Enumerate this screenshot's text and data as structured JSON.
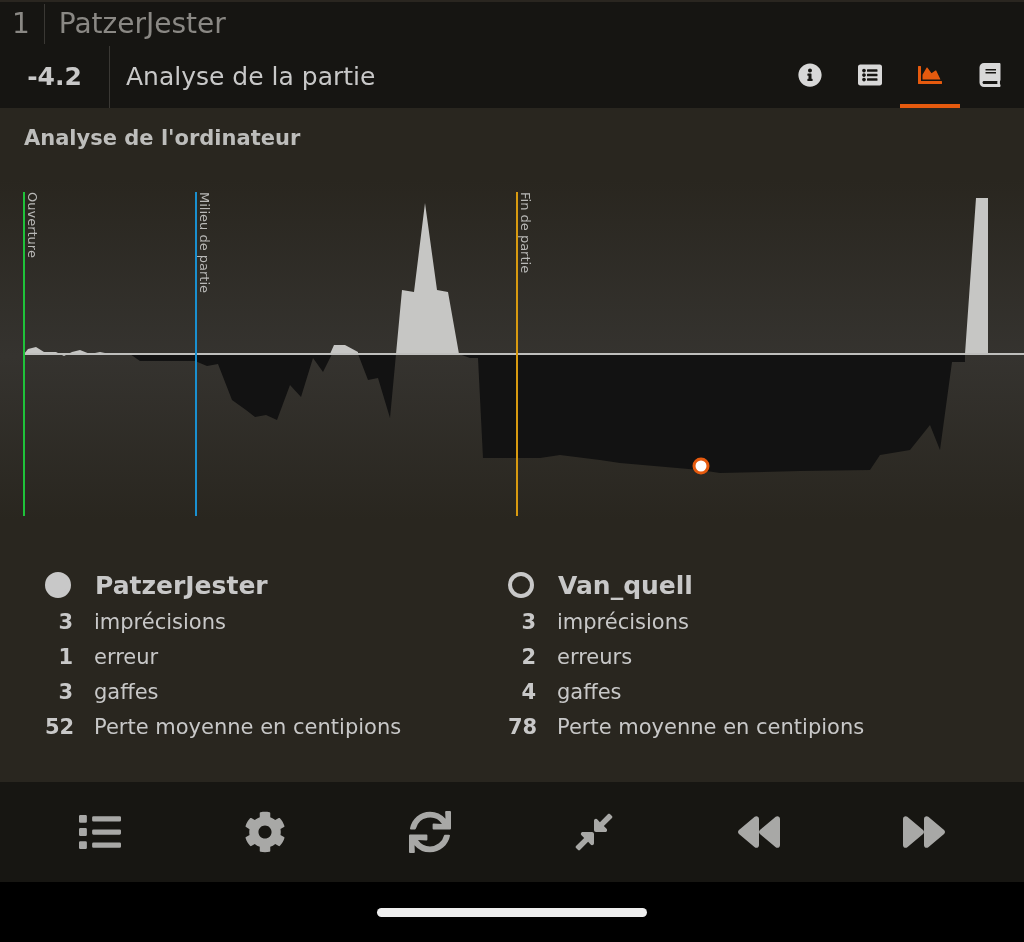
{
  "top_bar": {
    "move_number": "1",
    "player": "PatzerJester"
  },
  "header": {
    "evaluation": "-4.2",
    "title": "Analyse de la partie",
    "tabs": [
      {
        "kind": "info",
        "selected": false
      },
      {
        "kind": "list",
        "selected": false
      },
      {
        "kind": "chart",
        "selected": true
      },
      {
        "kind": "book",
        "selected": false
      }
    ]
  },
  "section_title": "Analyse de l'ordinateur",
  "phases": [
    {
      "label": "Ouverture",
      "color": "#1fc23a"
    },
    {
      "label": "Milieu de partie",
      "color": "#1a90d0"
    },
    {
      "label": "Fin de partie",
      "color": "#d89a10"
    }
  ],
  "players": [
    {
      "name": "PatzerJester",
      "kind": "white",
      "stats": [
        {
          "count": "3",
          "label": "imprécisions"
        },
        {
          "count": "1",
          "label": "erreur"
        },
        {
          "count": "3",
          "label": "gaffes"
        },
        {
          "count": "52",
          "label": "Perte moyenne en centipions"
        }
      ]
    },
    {
      "name": "Van_quell",
      "kind": "black",
      "stats": [
        {
          "count": "3",
          "label": "imprécisions"
        },
        {
          "count": "2",
          "label": "erreurs"
        },
        {
          "count": "4",
          "label": "gaffes"
        },
        {
          "count": "78",
          "label": "Perte moyenne en centipions"
        }
      ]
    }
  ],
  "toolbar": [
    {
      "kind": "menu"
    },
    {
      "kind": "settings"
    },
    {
      "kind": "flip"
    },
    {
      "kind": "compress"
    },
    {
      "kind": "back"
    },
    {
      "kind": "forward"
    }
  ]
}
